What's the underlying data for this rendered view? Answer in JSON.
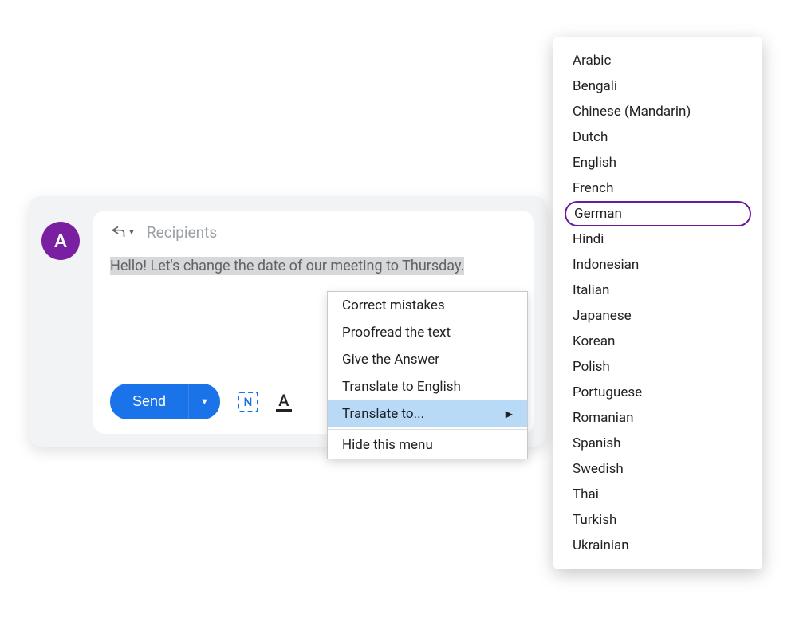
{
  "avatar": {
    "initial": "A"
  },
  "recipients": {
    "placeholder": "Recipients"
  },
  "message": {
    "body": "Hello! Let's change the date of our meeting to Thursday."
  },
  "toolbar": {
    "send_label": "Send",
    "n_icon_label": "N",
    "format_icon_label": "A"
  },
  "context_menu": {
    "items": [
      {
        "label": "Correct mistakes"
      },
      {
        "label": "Proofread the text"
      },
      {
        "label": "Give the Answer"
      },
      {
        "label": "Translate to English"
      },
      {
        "label": "Translate to...",
        "submenu": true,
        "highlighted": true
      },
      {
        "label": "Hide this menu",
        "separator_before": true
      }
    ]
  },
  "languages": {
    "selected": "German",
    "items": [
      "Arabic",
      "Bengali",
      "Chinese (Mandarin)",
      "Dutch",
      "English",
      "French",
      "German",
      "Hindi",
      "Indonesian",
      "Italian",
      "Japanese",
      "Korean",
      "Polish",
      "Portuguese",
      "Romanian",
      "Spanish",
      "Swedish",
      "Thai",
      "Turkish",
      "Ukrainian"
    ]
  }
}
